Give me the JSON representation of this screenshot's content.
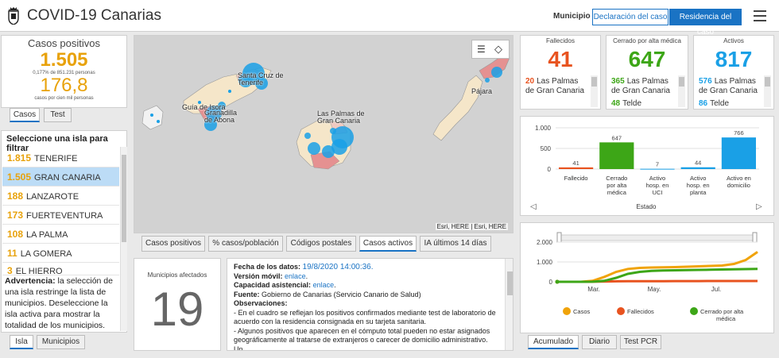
{
  "header": {
    "title": "COVID-19 Canarias",
    "municipio_label": "Municipio",
    "btn_declaracion": "Declaración del caso",
    "btn_residencia": "Residencia del caso"
  },
  "casos": {
    "title": "Casos positivos",
    "value": "1.505",
    "sub": "0,177% de 851.231 personas",
    "rate": "176,8",
    "rate_sub": "casos por cien mil personas",
    "tabs": [
      "Casos",
      "Test"
    ]
  },
  "islands": {
    "title": "Seleccione una isla para filtrar",
    "items": [
      {
        "n": "1.815",
        "name": "TENERIFE"
      },
      {
        "n": "1.505",
        "name": "GRAN CANARIA"
      },
      {
        "n": "188",
        "name": "LANZAROTE"
      },
      {
        "n": "173",
        "name": "FUERTEVENTURA"
      },
      {
        "n": "108",
        "name": "LA PALMA"
      },
      {
        "n": "11",
        "name": "LA GOMERA"
      },
      {
        "n": "3",
        "name": "EL HIERRO"
      }
    ],
    "warning_bold": "Advertencia:",
    "warning": " la selección de una isla restringe la lista de municipios. Deseleccione la isla activa para mostrar la totalidad de los municipios.",
    "tabs": [
      "Isla",
      "Municipios"
    ]
  },
  "map": {
    "labels": {
      "santa_cruz": "Santa Cruz de Tenerife",
      "guia": "Guía de Isora",
      "granadilla": "Granadilla de Abona",
      "las_palmas": "Las Palmas de Gran Canaria",
      "pajara": "Pájara"
    },
    "attribution": "Esri, HERE | Esri, HERE",
    "tabs": [
      "Casos positivos",
      "% casos/población",
      "Códigos postales",
      "Casos activos",
      "IA últimos 14 días"
    ],
    "active_tab": 3
  },
  "municipios": {
    "title": "Municipios afectados",
    "value": "19"
  },
  "info": {
    "fecha_label": "Fecha de los datos:",
    "fecha": "19/8/2020 14:00:36.",
    "movil_label": "Versión móvil:",
    "movil_link": "enlace",
    "capacidad_label": "Capacidad asistencial:",
    "capacidad_link": "enlace",
    "fuente_label": "Fuente:",
    "fuente": "Gobierno de Canarias (Servicio Canario de Salud)",
    "obs_label": "Observaciones:",
    "obs1": "- En el cuadro se reflejan los positivos confirmados mediante test de laboratorio de acuerdo con la residencia consignada en su tarjeta sanitaria.",
    "obs2": "- Algunos positivos que aparecen en el cómputo total pueden no estar asignados geográficamente al tratarse de extranjeros o carecer de domicilio administrativo. Un"
  },
  "cards": {
    "fallecidos": {
      "title": "Fallecidos",
      "value": "41",
      "color": "#e8531f",
      "rows": [
        {
          "n": "20",
          "name": "Las Palmas de Gran Canaria"
        }
      ]
    },
    "cerrado": {
      "title": "Cerrado por alta médica",
      "value": "647",
      "color": "#3da617",
      "rows": [
        {
          "n": "365",
          "name": "Las Palmas de Gran Canaria"
        },
        {
          "n": "48",
          "name": "Telde"
        }
      ]
    },
    "activos": {
      "title": "Activos",
      "value": "817",
      "color": "#1aa0e6",
      "rows": [
        {
          "n": "576",
          "name": "Las Palmas de Gran Canaria"
        },
        {
          "n": "86",
          "name": "Telde"
        }
      ]
    }
  },
  "chart_data": [
    {
      "type": "bar",
      "categories": [
        "Fallecido",
        "Cerrado por alta médica",
        "Activo hosp. en UCI",
        "Activo hosp. en planta",
        "Activo en domicilio"
      ],
      "values": [
        41,
        647,
        7,
        44,
        766
      ],
      "colors": [
        "#e8531f",
        "#3da617",
        "#1aa0e6",
        "#1aa0e6",
        "#1aa0e6"
      ],
      "xlabel": "Estado",
      "ylim": [
        0,
        1000
      ],
      "yticks": [
        "0",
        "500",
        "1.000"
      ]
    },
    {
      "type": "line",
      "x_ticks": [
        "Mar.",
        "May.",
        "Jul."
      ],
      "yticks": [
        "0",
        "1.000",
        "2.000"
      ],
      "ylim": [
        0,
        2000
      ],
      "series": [
        {
          "name": "Casos",
          "color": "#f0a30a",
          "values": [
            0,
            0,
            0,
            50,
            250,
            500,
            650,
            700,
            720,
            730,
            740,
            760,
            780,
            800,
            820,
            900,
            1100,
            1505
          ]
        },
        {
          "name": "Fallecidos",
          "color": "#e8531f",
          "values": [
            0,
            0,
            0,
            5,
            15,
            25,
            30,
            32,
            33,
            34,
            35,
            36,
            37,
            38,
            39,
            40,
            40,
            41
          ]
        },
        {
          "name": "Cerrado por alta médica",
          "color": "#3da617",
          "values": [
            0,
            0,
            0,
            5,
            50,
            200,
            400,
            500,
            550,
            570,
            580,
            590,
            600,
            610,
            620,
            630,
            640,
            647
          ]
        }
      ],
      "tabs": [
        "Acumulado",
        "Diario",
        "Test PCR"
      ]
    }
  ]
}
